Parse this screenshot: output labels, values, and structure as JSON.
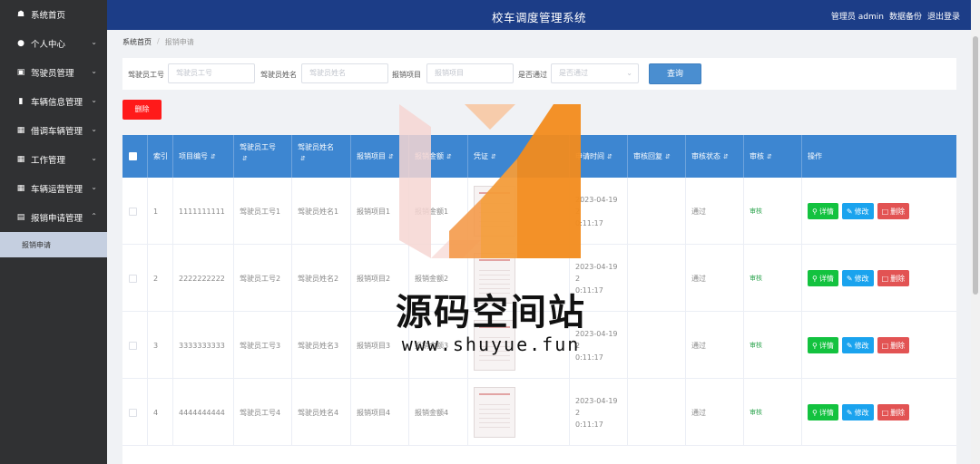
{
  "header": {
    "title": "校车调度管理系统",
    "user": "管理员 admin",
    "backup": "数据备份",
    "logout": "退出登录"
  },
  "sidebar": {
    "items": [
      {
        "label": "系统首页",
        "icon": "home-icon"
      },
      {
        "label": "个人中心",
        "icon": "person-icon"
      },
      {
        "label": "驾驶员管理",
        "icon": "driver-icon"
      },
      {
        "label": "车辆信息管理",
        "icon": "monitor-icon"
      },
      {
        "label": "借调车辆管理",
        "icon": "grid-icon"
      },
      {
        "label": "工作管理",
        "icon": "grid-icon"
      },
      {
        "label": "车辆运营管理",
        "icon": "grid-icon"
      },
      {
        "label": "报销申请管理",
        "icon": "doc-icon"
      }
    ],
    "sub_item": "报销申请"
  },
  "breadcrumb": {
    "home": "系统首页",
    "current": "报销申请"
  },
  "search": {
    "driver_id_label": "驾驶员工号",
    "driver_id_placeholder": "驾驶员工号",
    "driver_name_label": "驾驶员姓名",
    "driver_name_placeholder": "驾驶员姓名",
    "project_label": "报销项目",
    "project_placeholder": "报销项目",
    "approved_label": "是否通过",
    "approved_placeholder": "是否通过",
    "query_button": "查询"
  },
  "toolbar": {
    "delete_label": "删除"
  },
  "table": {
    "columns": {
      "index": "索引",
      "project_no": "项目编号",
      "driver_id": "驾驶员工号",
      "driver_name": "驾驶员姓名",
      "project": "报销项目",
      "amount": "报销金额",
      "voucher": "凭证",
      "apply_time": "申请时间",
      "review_reply": "审核回复",
      "review_status": "审核状态",
      "review": "审核",
      "actions": "操作"
    },
    "rows": [
      {
        "index": "1",
        "project_no": "1111111111",
        "driver_id": "驾驶员工号1",
        "driver_name": "驾驶员姓名1",
        "project": "报销项目1",
        "amount": "报销金额1",
        "time_1": "2023-04-19 2",
        "time_2": "0:11:17",
        "status": "通过",
        "review": "审核"
      },
      {
        "index": "2",
        "project_no": "2222222222",
        "driver_id": "驾驶员工号2",
        "driver_name": "驾驶员姓名2",
        "project": "报销项目2",
        "amount": "报销金额2",
        "time_1": "2023-04-19 2",
        "time_2": "0:11:17",
        "status": "通过",
        "review": "审核"
      },
      {
        "index": "3",
        "project_no": "3333333333",
        "driver_id": "驾驶员工号3",
        "driver_name": "驾驶员姓名3",
        "project": "报销项目3",
        "amount": "报销金额3",
        "time_1": "2023-04-19 2",
        "time_2": "0:11:17",
        "status": "通过",
        "review": "审核"
      },
      {
        "index": "4",
        "project_no": "4444444444",
        "driver_id": "驾驶员工号4",
        "driver_name": "驾驶员姓名4",
        "project": "报销项目4",
        "amount": "报销金额4",
        "time_1": "2023-04-19 2",
        "time_2": "0:11:17",
        "status": "通过",
        "review": "审核"
      }
    ],
    "actions": {
      "detail": "详情",
      "edit": "修改",
      "delete": "删除"
    }
  },
  "watermark": {
    "text": "源码空间站",
    "url": "www.shuyue.fun"
  }
}
